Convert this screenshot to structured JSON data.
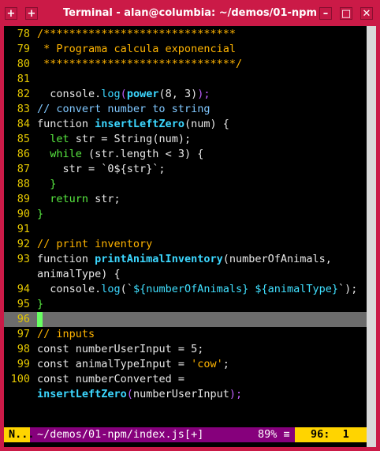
{
  "window": {
    "title": "Terminal - alan@columbia: ~/demos/01-npm",
    "menu_button": "+",
    "minimize_button": "–",
    "maximize_button": "□",
    "close_button": "✕"
  },
  "lines": [
    {
      "n": "78",
      "segs": [
        {
          "t": "/******************************",
          "c": "cm"
        }
      ]
    },
    {
      "n": "79",
      "segs": [
        {
          "t": " * Programa calcula exponencial",
          "c": "cm"
        }
      ]
    },
    {
      "n": "80",
      "segs": [
        {
          "t": " ******************************/",
          "c": "cm"
        }
      ]
    },
    {
      "n": "81",
      "segs": []
    },
    {
      "n": "82",
      "segs": [
        {
          "t": "  console.",
          "c": ""
        },
        {
          "t": "log",
          "c": "log"
        },
        {
          "t": "(",
          "c": "br"
        },
        {
          "t": "power",
          "c": "fn"
        },
        {
          "t": "(8, 3)",
          "c": ""
        },
        {
          "t": ");",
          "c": "br"
        }
      ]
    },
    {
      "n": "83",
      "segs": [
        {
          "t": "// convert number to string",
          "c": "cm2"
        }
      ]
    },
    {
      "n": "84",
      "segs": [
        {
          "t": "function ",
          "c": ""
        },
        {
          "t": "insertLeftZero",
          "c": "fn"
        },
        {
          "t": "(num) {",
          "c": ""
        }
      ]
    },
    {
      "n": "85",
      "segs": [
        {
          "t": "  let ",
          "c": "kw"
        },
        {
          "t": "str = String(num);",
          "c": ""
        }
      ]
    },
    {
      "n": "86",
      "segs": [
        {
          "t": "  while ",
          "c": "kw"
        },
        {
          "t": "(str.length < 3) {",
          "c": ""
        }
      ]
    },
    {
      "n": "87",
      "segs": [
        {
          "t": "    str = `0${str}`;",
          "c": ""
        }
      ]
    },
    {
      "n": "88",
      "segs": [
        {
          "t": "  }",
          "c": "kw"
        }
      ]
    },
    {
      "n": "89",
      "segs": [
        {
          "t": "  return ",
          "c": "kw"
        },
        {
          "t": "str;",
          "c": ""
        }
      ]
    },
    {
      "n": "90",
      "segs": [
        {
          "t": "}",
          "c": "kw"
        }
      ]
    },
    {
      "n": "91",
      "segs": []
    },
    {
      "n": "92",
      "segs": [
        {
          "t": "// print inventory",
          "c": "cm"
        }
      ]
    },
    {
      "n": "93",
      "segs": [
        {
          "t": "function ",
          "c": ""
        },
        {
          "t": "printAnimalInventory",
          "c": "fn"
        },
        {
          "t": "(numberOfAnimals,",
          "c": ""
        }
      ]
    },
    {
      "n": "",
      "segs": [
        {
          "t": "animalType) {",
          "c": ""
        }
      ]
    },
    {
      "n": "94",
      "segs": [
        {
          "t": "  console.",
          "c": ""
        },
        {
          "t": "log",
          "c": "log"
        },
        {
          "t": "(`",
          "c": ""
        },
        {
          "t": "${numberOfAnimals} ${animalType}",
          "c": "tmpl"
        },
        {
          "t": "`);",
          "c": ""
        }
      ]
    },
    {
      "n": "95",
      "segs": [
        {
          "t": "}",
          "c": "kw"
        }
      ]
    },
    {
      "n": "96",
      "segs": [],
      "cursor": true
    },
    {
      "n": "97",
      "segs": [
        {
          "t": "// inputs",
          "c": "cm"
        }
      ]
    },
    {
      "n": "98",
      "segs": [
        {
          "t": "const ",
          "c": ""
        },
        {
          "t": "numberUserInput = 5;",
          "c": ""
        }
      ]
    },
    {
      "n": "99",
      "segs": [
        {
          "t": "const ",
          "c": ""
        },
        {
          "t": "animalTypeInput = ",
          "c": ""
        },
        {
          "t": "'cow'",
          "c": "str"
        },
        {
          "t": ";",
          "c": ""
        }
      ]
    },
    {
      "n": "100",
      "segs": [
        {
          "t": "const ",
          "c": ""
        },
        {
          "t": "numberConverted =",
          "c": ""
        }
      ]
    },
    {
      "n": "",
      "segs": [
        {
          "t": "insertLeftZero",
          "c": "fn"
        },
        {
          "t": "(",
          "c": "br"
        },
        {
          "t": "numberUserInput",
          "c": ""
        },
        {
          "t": ");",
          "c": "br"
        }
      ]
    }
  ],
  "status": {
    "mode": "N...",
    "file": "~/demos/01-npm/index.js[+]",
    "percent": "89%",
    "separator": "≡",
    "position": "96:  1"
  },
  "colors": {
    "titlebar": "#cb1a47",
    "statusbar": "#86007c",
    "accent": "#ffd400"
  }
}
